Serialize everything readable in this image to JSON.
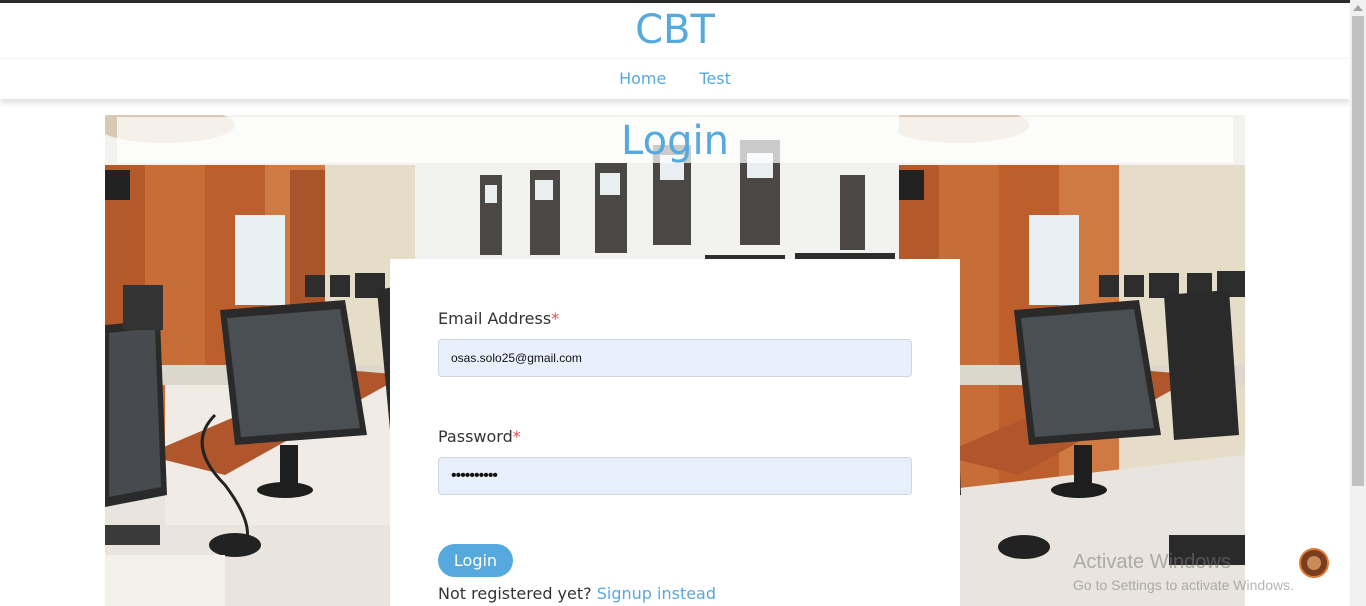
{
  "header": {
    "brand": "CBT",
    "nav": [
      "Home",
      "Test"
    ]
  },
  "page": {
    "title": "Login"
  },
  "form": {
    "email_label": "Email Address",
    "email_value": "osas.solo25@gmail.com",
    "password_label": "Password",
    "password_value": "••••••••••",
    "required_mark": "*",
    "login_button": "Login",
    "signup_prompt": "Not registered yet?",
    "signup_link": "Signup instead"
  },
  "watermark": {
    "title": "Activate Windows",
    "subtitle": "Go to Settings to activate Windows."
  },
  "icons": {
    "fab": "assistant-avatar-icon"
  },
  "colors": {
    "accent": "#56a9dc",
    "required": "#d9534f",
    "field_bg": "#e8f0fe"
  }
}
